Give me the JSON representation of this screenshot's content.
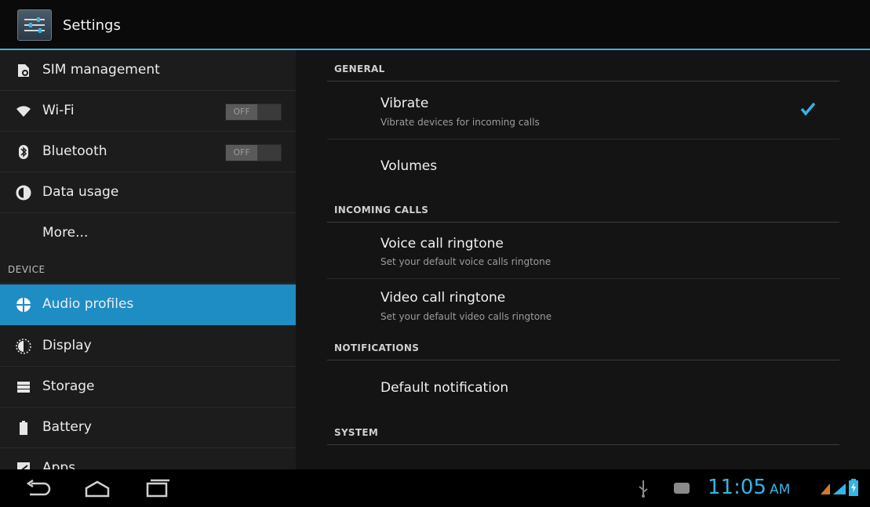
{
  "app": {
    "title": "Settings"
  },
  "sidebar": {
    "items": [
      {
        "label": "SIM management",
        "icon": "sim-icon"
      },
      {
        "label": "Wi-Fi",
        "icon": "wifi-icon",
        "toggle": "OFF"
      },
      {
        "label": "Bluetooth",
        "icon": "bluetooth-icon",
        "toggle": "OFF"
      },
      {
        "label": "Data usage",
        "icon": "data-usage-icon"
      },
      {
        "label": "More..."
      },
      {
        "label": "Audio profiles",
        "icon": "audio-profiles-icon",
        "selected": true
      },
      {
        "label": "Display",
        "icon": "display-icon"
      },
      {
        "label": "Storage",
        "icon": "storage-icon"
      },
      {
        "label": "Battery",
        "icon": "battery-icon"
      },
      {
        "label": "Apps",
        "icon": "apps-icon"
      }
    ],
    "device_header": "DEVICE"
  },
  "main": {
    "general": {
      "header": "GENERAL",
      "vibrate": {
        "title": "Vibrate",
        "summary": "Vibrate devices for incoming calls",
        "checked": true
      },
      "volumes": {
        "title": "Volumes"
      }
    },
    "incoming": {
      "header": "INCOMING CALLS",
      "voice": {
        "title": "Voice call ringtone",
        "summary": "Set your default voice calls ringtone"
      },
      "video": {
        "title": "Video call ringtone",
        "summary": "Set your default video calls ringtone"
      }
    },
    "notifications": {
      "header": "NOTIFICATIONS",
      "default": {
        "title": "Default notification"
      }
    },
    "system": {
      "header": "SYSTEM"
    }
  },
  "statusbar": {
    "time": "11:05",
    "ampm": "AM",
    "accent": "#33b5e5"
  },
  "colors": {
    "accent": "#33b5e5",
    "selected": "#1e8dc4"
  }
}
